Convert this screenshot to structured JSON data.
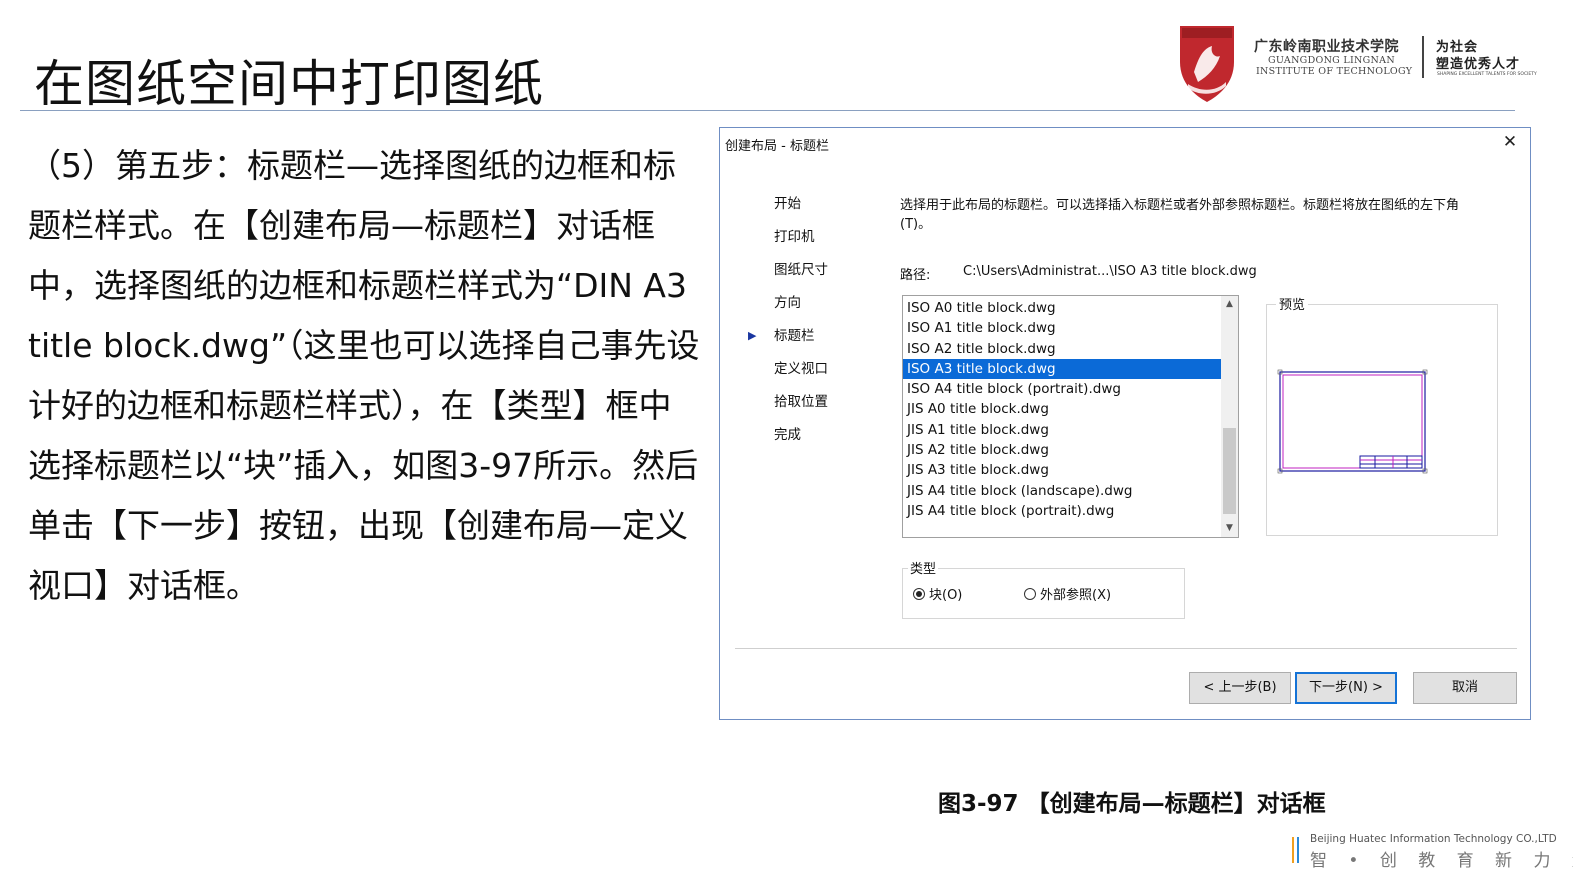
{
  "slide": {
    "title": "在图纸空间中打印图纸",
    "body": "（5）第五步：标题栏—选择图纸的边框和标题栏样式。在【创建布局—标题栏】对话框中，选择图纸的边框和标题栏样式为“DIN A3 title block.dwg”（这里也可以选择自己事先设计好的边框和标题栏样式），在【类型】框中选择标题栏以“块”插入，如图3-97所示。然后单击【下一步】按钮，出现【创建布局—定义视口】对话框。",
    "caption": "图3-97 【创建布局—标题栏】对话框"
  },
  "logo": {
    "school_cn": "广东岭南职业技术学院",
    "school_en_line1": "GUANGDONG LINGNAN",
    "school_en_line2": "INSTITUTE OF TECHNOLOGY",
    "motto_line1": "为社会",
    "motto_line2": "塑造优秀人才",
    "motto_en": "SHAPING EXCELLENT TALENTS FOR SOCIETY",
    "shield_color": "#c0282e"
  },
  "dialog": {
    "title": "创建布局 - 标题栏",
    "close_icon": "close-icon",
    "nav": [
      {
        "label": "开始",
        "current": false
      },
      {
        "label": "打印机",
        "current": false
      },
      {
        "label": "图纸尺寸",
        "current": false
      },
      {
        "label": "方向",
        "current": false
      },
      {
        "label": "标题栏",
        "current": true
      },
      {
        "label": "定义视口",
        "current": false
      },
      {
        "label": "拾取位置",
        "current": false
      },
      {
        "label": "完成",
        "current": false
      }
    ],
    "description": "选择用于此布局的标题栏。可以选择插入标题栏或者外部参照标题栏。标题栏将放在图纸的左下角(T)。",
    "path_label": "路径:",
    "path_value": "C:\\Users\\Administrat...\\ISO A3 title block.dwg",
    "files": [
      "ISO A0 title block.dwg",
      "ISO A1 title block.dwg",
      "ISO A2 title block.dwg",
      "ISO A3 title block.dwg",
      "ISO A4 title block (portrait).dwg",
      "JIS A0 title block.dwg",
      "JIS A1 title block.dwg",
      "JIS A2 title block.dwg",
      "JIS A3 title block.dwg",
      "JIS A4 title block (landscape).dwg",
      "JIS A4 title block (portrait).dwg"
    ],
    "selected_index": 3,
    "preview_label": "预览",
    "type_label": "类型",
    "radio_block": "块(O)",
    "radio_xref": "外部参照(X)",
    "radio_selected": "block",
    "btn_back": "< 上一步(B)",
    "btn_next": "下一步(N) >",
    "btn_cancel": "取消",
    "accent_color": "#0b6ad7"
  },
  "footer": {
    "brand_en": "Beijing Huatec Information Technology CO.,LTD",
    "brand_cn": "智 • 创 教 育 新 力 量"
  }
}
